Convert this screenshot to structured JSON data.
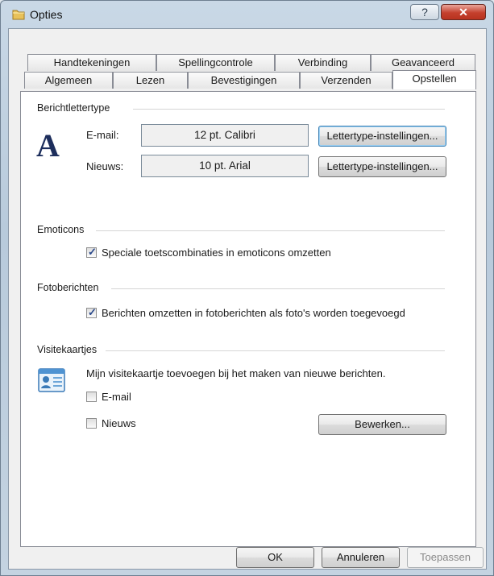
{
  "window": {
    "title": "Opties",
    "help_glyph": "?",
    "close_glyph": "✕"
  },
  "tabs_row1": [
    {
      "label": "Handtekeningen"
    },
    {
      "label": "Spellingcontrole"
    },
    {
      "label": "Verbinding"
    },
    {
      "label": "Geavanceerd"
    }
  ],
  "tabs_row2": [
    {
      "label": "Algemeen"
    },
    {
      "label": "Lezen"
    },
    {
      "label": "Bevestigingen"
    },
    {
      "label": "Verzenden"
    },
    {
      "label": "Opstellen",
      "active": true
    }
  ],
  "fonts_section": {
    "title": "Berichtlettertype",
    "icon_letter": "A",
    "email_label": "E-mail:",
    "email_value": "12 pt. Calibri",
    "email_button": "Lettertype-instellingen...",
    "news_label": "Nieuws:",
    "news_value": "10 pt. Arial",
    "news_button": "Lettertype-instellingen..."
  },
  "emoticons_section": {
    "title": "Emoticons",
    "checkbox_label": "Speciale toetscombinaties in emoticons omzetten",
    "checked": true
  },
  "photo_section": {
    "title": "Fotoberichten",
    "checkbox_label": "Berichten omzetten in fotoberichten als foto's worden toegevoegd",
    "checked": true
  },
  "vcard_section": {
    "title": "Visitekaartjes",
    "description": "Mijn visitekaartje toevoegen bij het maken van nieuwe berichten.",
    "email_label": "E-mail",
    "email_checked": false,
    "news_label": "Nieuws",
    "news_checked": false,
    "edit_button": "Bewerken..."
  },
  "footer": {
    "ok": "OK",
    "cancel": "Annuleren",
    "apply": "Toepassen"
  },
  "icons": [
    "folder-icon",
    "help-icon",
    "close-icon",
    "font-icon",
    "contact-card-icon",
    "checkmark-icon"
  ],
  "colors": {
    "close_red": "#c4402d",
    "title_bg": "#b8cadb",
    "check_mark": "#2c4a8c"
  }
}
